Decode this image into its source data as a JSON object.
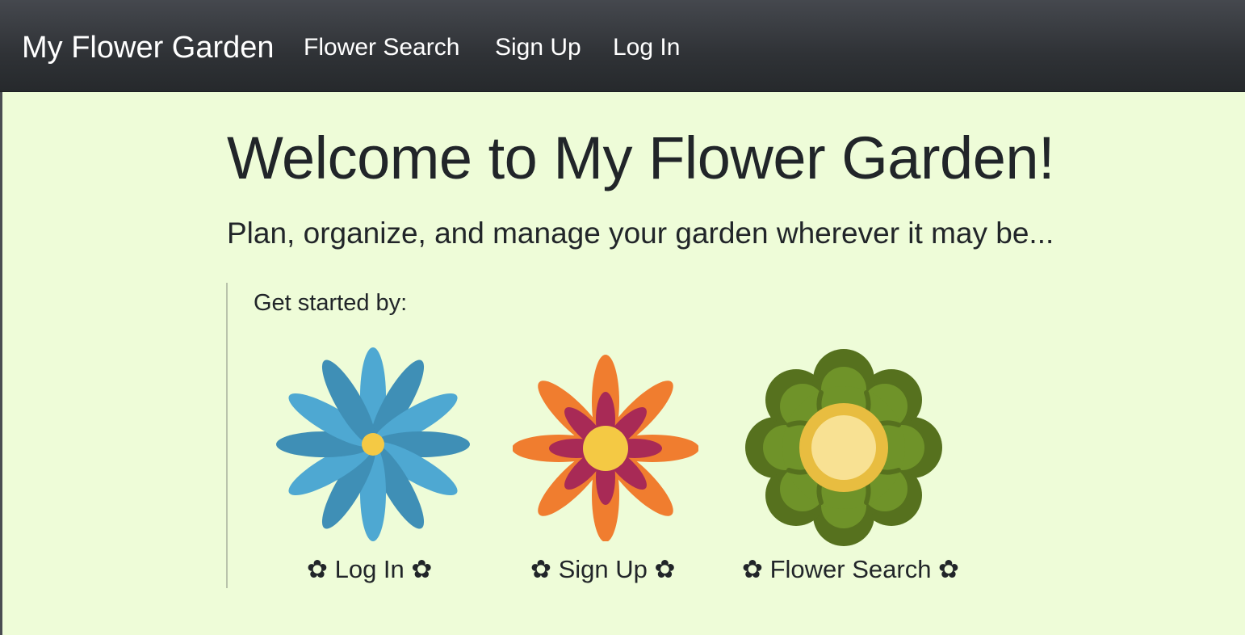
{
  "nav": {
    "brand": "My Flower Garden",
    "links": [
      {
        "label": "Flower Search"
      },
      {
        "label": "Sign Up"
      },
      {
        "label": "Log In"
      }
    ]
  },
  "hero": {
    "title": "Welcome to My Flower Garden!",
    "subtitle": "Plan, organize, and manage your garden wherever it may be..."
  },
  "get_started": {
    "label": "Get started by:",
    "options": [
      {
        "label": "✿ Log In ✿",
        "icon": "blue-daisy-flower-icon"
      },
      {
        "label": "✿ Sign Up ✿",
        "icon": "orange-flower-icon"
      },
      {
        "label": "✿ Flower Search ✿",
        "icon": "green-flower-icon"
      }
    ]
  },
  "colors": {
    "background": "#eefcd8",
    "navbar": "#2f3236",
    "text": "#212529",
    "blue_petal": "#4ea8d2",
    "orange_petal": "#f07d2f",
    "magenta_petal": "#a82a56",
    "yellow_center": "#f4c944",
    "green_outer": "#56711e",
    "green_inner": "#6f9329"
  }
}
